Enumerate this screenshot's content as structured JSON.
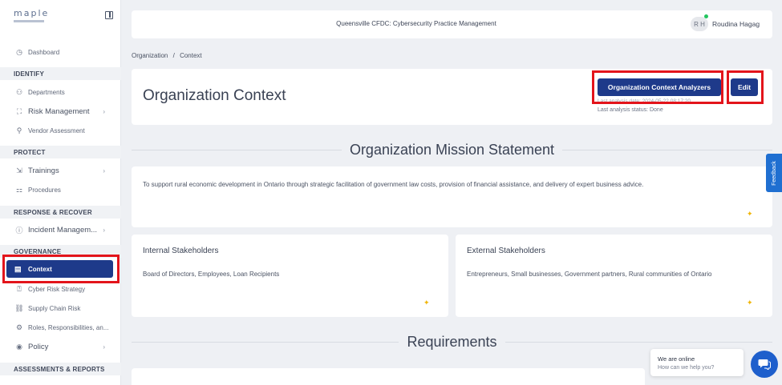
{
  "app": {
    "brand": "maple"
  },
  "sidebar": {
    "dashboard": "Dashboard",
    "sections": {
      "identify": "IDENTIFY",
      "protect": "PROTECT",
      "response": "RESPONSE & RECOVER",
      "governance": "GOVERNANCE",
      "assessments": "ASSESSMENTS & REPORTS"
    },
    "items": {
      "departments": "Departments",
      "risk_management": "Risk Management",
      "vendor_assessment": "Vendor Assessment",
      "trainings": "Trainings",
      "procedures": "Procedures",
      "incident_management": "Incident Managem...",
      "context": "Context",
      "cyber_risk_strategy": "Cyber Risk Strategy",
      "supply_chain_risk": "Supply Chain Risk",
      "roles": "Roles, Responsibilities, an...",
      "policy": "Policy"
    }
  },
  "header": {
    "title": "Queensville CFDC: Cybersecurity Practice Management",
    "avatar_initials": "R H",
    "user_name": "Roudina Hagag"
  },
  "breadcrumb": {
    "parent": "Organization",
    "separator": "/",
    "current": "Context"
  },
  "page": {
    "title": "Organization Context",
    "analyzers_button": "Organization Context Analyzers",
    "edit_button": "Edit",
    "last_analysis_date": "Last analysis date: 2024-05-22 08:17:20",
    "last_analysis_status": "Last analysis status: Done"
  },
  "mission": {
    "heading": "Organization Mission Statement",
    "text": "To support rural economic development in Ontario through strategic facilitation of government law costs, provision of financial assistance, and delivery of expert business advice."
  },
  "internal_stakeholders": {
    "title": "Internal Stakeholders",
    "text": "Board of Directors, Employees, Loan Recipients"
  },
  "external_stakeholders": {
    "title": "External Stakeholders",
    "text": "Entrepreneurs, Small businesses, Government partners, Rural communities of Ontario"
  },
  "requirements": {
    "heading": "Requirements"
  },
  "feedback_tab": "Feedback",
  "chat": {
    "status": "We are online",
    "prompt": "How can we help you?"
  },
  "colors": {
    "primary": "#1e3a8a",
    "highlight": "#e3141b",
    "online": "#22c55e",
    "feedback": "#1f6fd1"
  }
}
